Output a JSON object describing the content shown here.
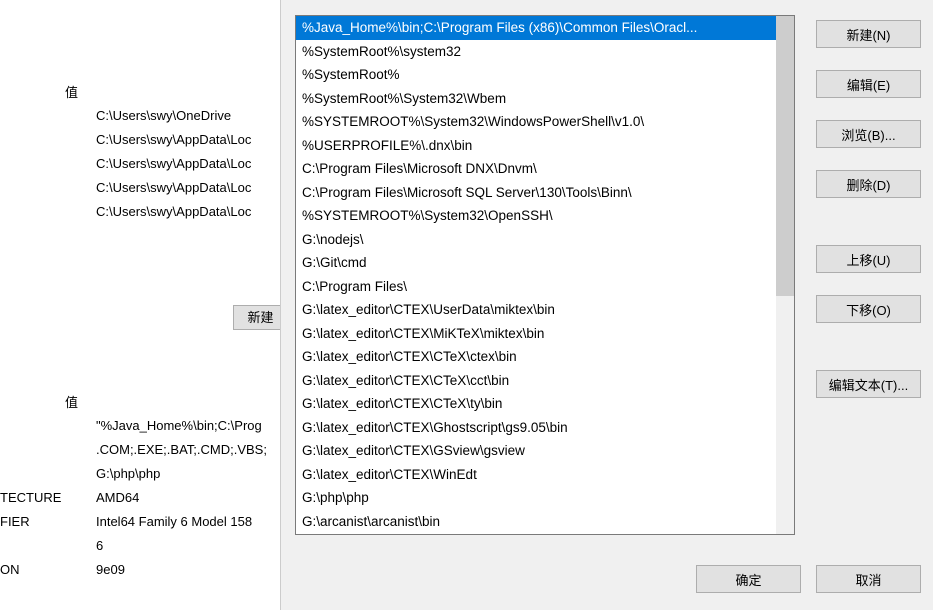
{
  "background": {
    "header1": "值",
    "rows1": [
      "C:\\Users\\swy\\OneDrive",
      "C:\\Users\\swy\\AppData\\Loc",
      "C:\\Users\\swy\\AppData\\Loc",
      "C:\\Users\\swy\\AppData\\Loc",
      "C:\\Users\\swy\\AppData\\Loc"
    ],
    "new_button": "新建",
    "header2": "值",
    "labels2": [
      "",
      "",
      "",
      "TECTURE",
      "FIER",
      "",
      "ON"
    ],
    "rows2": [
      "\"%Java_Home%\\bin;C:\\Prog",
      ".COM;.EXE;.BAT;.CMD;.VBS;",
      "G:\\php\\php",
      "AMD64",
      "Intel64 Family 6 Model 158",
      "6",
      "9e09"
    ]
  },
  "dialog": {
    "paths": [
      "%Java_Home%\\bin;C:\\Program Files (x86)\\Common Files\\Oracl...",
      "%SystemRoot%\\system32",
      "%SystemRoot%",
      "%SystemRoot%\\System32\\Wbem",
      "%SYSTEMROOT%\\System32\\WindowsPowerShell\\v1.0\\",
      "%USERPROFILE%\\.dnx\\bin",
      "C:\\Program Files\\Microsoft DNX\\Dnvm\\",
      "C:\\Program Files\\Microsoft SQL Server\\130\\Tools\\Binn\\",
      "%SYSTEMROOT%\\System32\\OpenSSH\\",
      "G:\\nodejs\\",
      "G:\\Git\\cmd",
      "C:\\Program Files\\",
      "G:\\latex_editor\\CTEX\\UserData\\miktex\\bin",
      "G:\\latex_editor\\CTEX\\MiKTeX\\miktex\\bin",
      "G:\\latex_editor\\CTEX\\CTeX\\ctex\\bin",
      "G:\\latex_editor\\CTEX\\CTeX\\cct\\bin",
      "G:\\latex_editor\\CTEX\\CTeX\\ty\\bin",
      "G:\\latex_editor\\CTEX\\Ghostscript\\gs9.05\\bin",
      "G:\\latex_editor\\CTEX\\GSview\\gsview",
      "G:\\latex_editor\\CTEX\\WinEdt",
      "G:\\php\\php",
      "G:\\arcanist\\arcanist\\bin"
    ],
    "selected_index": 0,
    "buttons": {
      "new": "新建(N)",
      "edit": "编辑(E)",
      "browse": "浏览(B)...",
      "delete": "删除(D)",
      "moveup": "上移(U)",
      "movedown": "下移(O)",
      "edittext": "编辑文本(T)...",
      "ok": "确定",
      "cancel": "取消"
    }
  }
}
